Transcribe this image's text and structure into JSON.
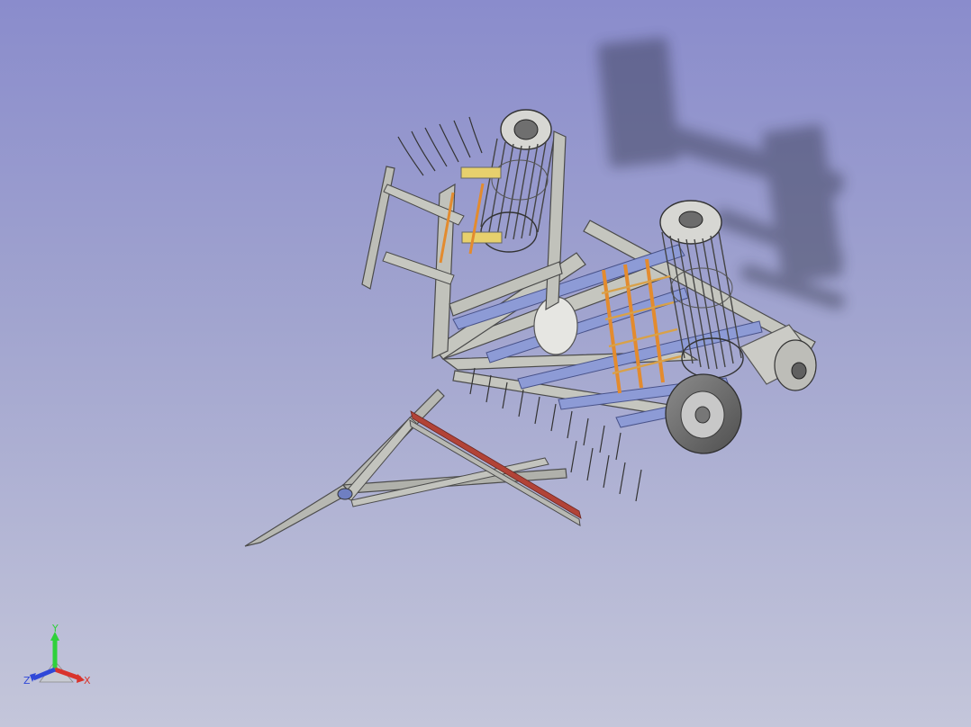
{
  "viewport": {
    "background_top": "#8a8ccc",
    "background_bottom": "#c4c6da"
  },
  "model": {
    "frame_color": "#b9bbb6",
    "steel_color": "#8d9bd6",
    "accent_orange": "#e38b2e",
    "accent_yellow": "#e7d06d",
    "accent_red": "#b24337"
  },
  "triad": {
    "x_label": "X",
    "y_label": "Y",
    "z_label": "Z",
    "x_color": "#d9342c",
    "y_color": "#2fd13a",
    "z_color": "#2f48d8"
  }
}
